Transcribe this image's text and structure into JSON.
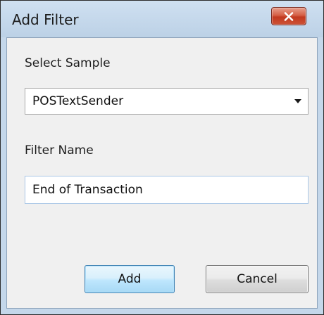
{
  "window": {
    "title": "Add Filter",
    "close_icon": "close-icon"
  },
  "form": {
    "sample_label": "Select Sample",
    "sample_selected": "POSTextSender",
    "filter_name_label": "Filter Name",
    "filter_name_value": "End of Transaction"
  },
  "buttons": {
    "add_label": "Add",
    "cancel_label": "Cancel"
  },
  "colors": {
    "title_bar": "#c4d7ea",
    "close_button": "#c7432a",
    "client_area": "#f0f0f0",
    "default_button_border": "#3c7fb1"
  }
}
